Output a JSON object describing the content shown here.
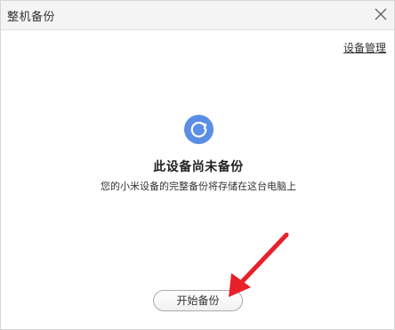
{
  "window": {
    "title": "整机备份"
  },
  "header": {
    "manage_link": "设备管理"
  },
  "status": {
    "icon": "refresh-circle-icon",
    "heading": "此设备尚未备份",
    "description": "您的小米设备的完整备份将存储在这台电脑上"
  },
  "actions": {
    "start_button": "开始备份"
  },
  "colors": {
    "accent": "#5b8ee6",
    "annotation": "#e8202a"
  }
}
